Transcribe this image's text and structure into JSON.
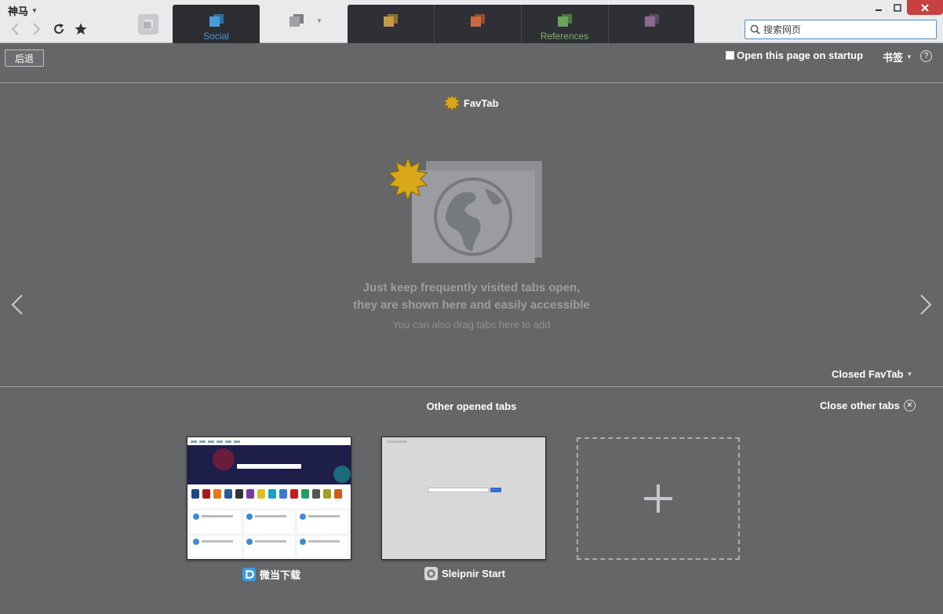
{
  "browser": {
    "app_menu": "神马",
    "search_placeholder": "搜索网页"
  },
  "tab_groups": [
    {
      "label": "Social",
      "icon_color": "#4b9ad8",
      "active": true
    },
    {
      "label": "",
      "icon_color": "#9fa1a4",
      "active": false
    },
    {
      "label": "",
      "icon_color": "#c39a4a",
      "active": false
    },
    {
      "label": "",
      "icon_color": "#c76a44",
      "active": false
    },
    {
      "label": "References",
      "icon_color": "#6aa35a",
      "active": false
    },
    {
      "label": "",
      "icon_color": "#8a6a8f",
      "active": false
    }
  ],
  "toolbar": {
    "back_label": "后退",
    "startup_label": "Open this page on startup",
    "startup_checked": false,
    "bookmarks_label": "书签",
    "help_label": "?"
  },
  "favtab": {
    "title": "FavTab",
    "message_line1": "Just keep frequently visited tabs open,",
    "message_line2": "they are shown here and easily accessible",
    "message_hint": "You can also drag tabs here to add",
    "closed_label": "Closed FavTab"
  },
  "other_tabs": {
    "title": "Other opened tabs",
    "close_label": "Close other tabs",
    "tabs": [
      {
        "title": "微当下载"
      },
      {
        "title": "Sleipnir Start"
      }
    ]
  },
  "colors": {
    "background": "#646668",
    "accent_blue": "#4b9ad8",
    "close_red": "#c94040"
  }
}
